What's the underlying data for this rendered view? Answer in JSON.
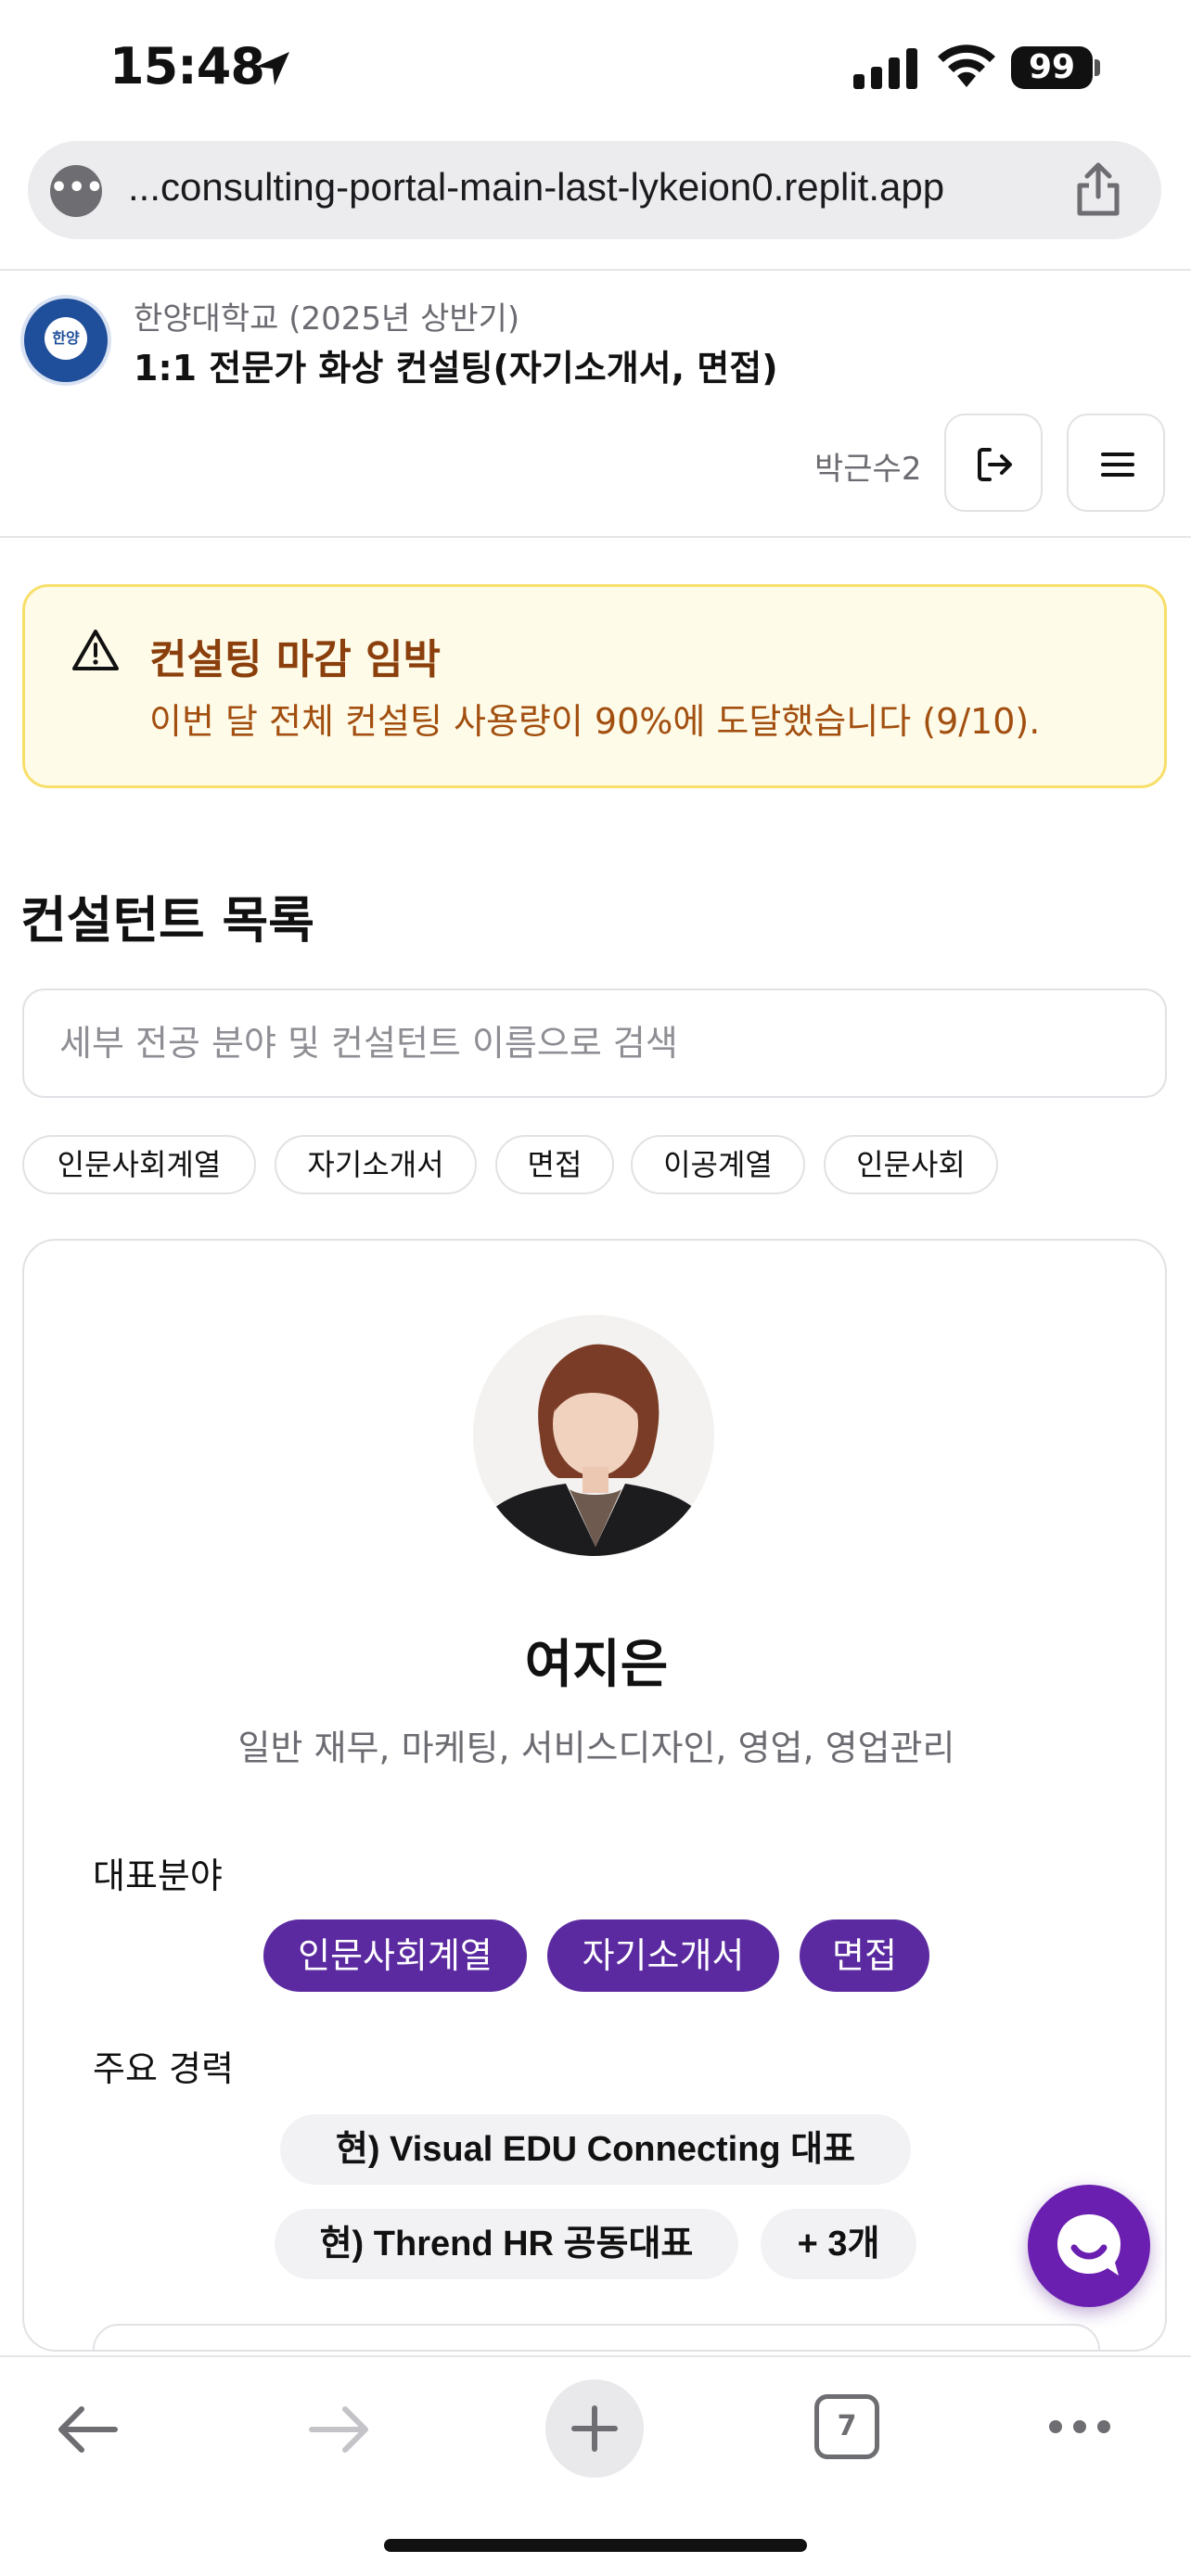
{
  "status_bar": {
    "time": "15:48",
    "battery": "99"
  },
  "browser": {
    "url": "...consulting-portal-main-last-lykeion0.replit.app",
    "tab_count": "7"
  },
  "header": {
    "org_subtitle": "한양대학교 (2025년 상반기)",
    "org_title": "1:1 전문가 화상 컨설팅(자기소개서, 면접)",
    "logo_text": "한양",
    "username": "박근수2"
  },
  "alert": {
    "title": "컨설팅 마감 임박",
    "message": "이번 달 전체 컨설팅 사용량이 90%에 도달했습니다 (9/10)."
  },
  "consultant_list": {
    "title": "컨설턴트 목록",
    "search_placeholder": "세부 전공 분야 및 컨설턴트 이름으로 검색",
    "filters": [
      "인문사회계열",
      "자기소개서",
      "면접",
      "이공계열",
      "인문사회"
    ]
  },
  "consultant": {
    "name": "여지은",
    "fields": "일반 재무, 마케팅, 서비스디자인, 영업, 영업관리",
    "specialty_label": "대표분야",
    "specialties": [
      "인문사회계열",
      "자기소개서",
      "면접"
    ],
    "career_label": "주요 경력",
    "careers": [
      "현) Visual EDU Connecting 대표",
      "현) Thrend HR 공동대표"
    ],
    "more_careers": "+ 3개"
  },
  "colors": {
    "accent_purple": "#5b2aa0",
    "alert_bg": "#fefbe8",
    "alert_border": "#f7df6a",
    "alert_text": "#a24f10"
  },
  "icons": {
    "location": "location-arrow-icon",
    "logout": "logout-icon",
    "menu": "hamburger-menu-icon",
    "alert": "warning-triangle-icon",
    "chat": "chat-bubble-icon"
  }
}
